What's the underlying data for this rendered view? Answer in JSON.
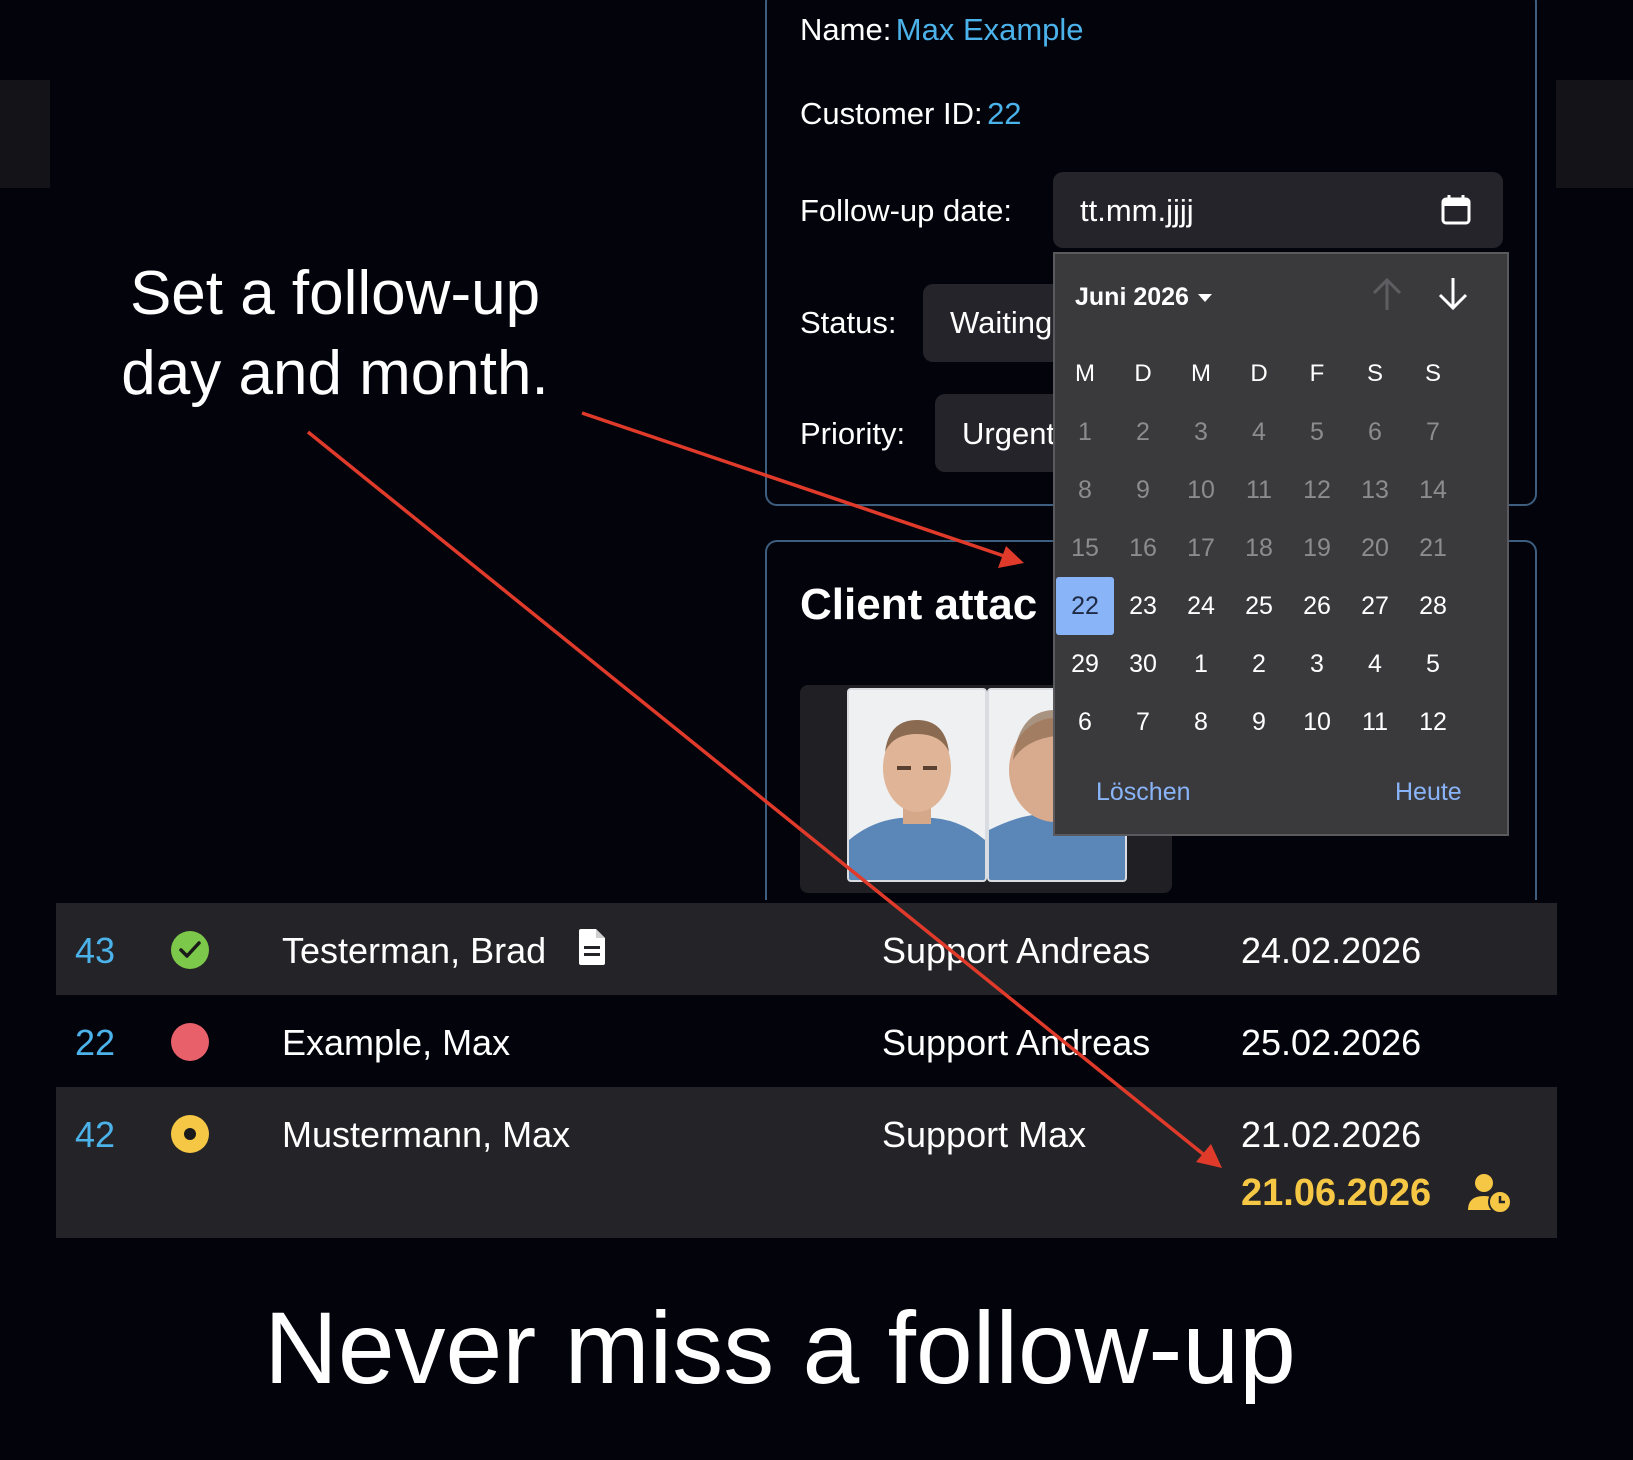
{
  "customer": {
    "name_label": "Name:",
    "name_value": "Max Example",
    "id_label": "Customer ID:",
    "id_value": "22",
    "followup_label": "Follow-up date:",
    "followup_placeholder": "tt.mm.jjjj",
    "status_label": "Status:",
    "status_value": "Waiting",
    "priority_label": "Priority:",
    "priority_value": "Urgent"
  },
  "attachments": {
    "title": "Client attac"
  },
  "calendar": {
    "month_label": "Juni 2026",
    "weekdays": [
      "M",
      "D",
      "M",
      "D",
      "F",
      "S",
      "S"
    ],
    "weeks": [
      [
        "1",
        "2",
        "3",
        "4",
        "5",
        "6",
        "7"
      ],
      [
        "8",
        "9",
        "10",
        "11",
        "12",
        "13",
        "14"
      ],
      [
        "15",
        "16",
        "17",
        "18",
        "19",
        "20",
        "21"
      ],
      [
        "22",
        "23",
        "24",
        "25",
        "26",
        "27",
        "28"
      ],
      [
        "29",
        "30",
        "1",
        "2",
        "3",
        "4",
        "5"
      ],
      [
        "6",
        "7",
        "8",
        "9",
        "10",
        "11",
        "12"
      ]
    ],
    "selected_day": "22",
    "clear_label": "Löschen",
    "today_label": "Heute",
    "icons": [
      "calendar-icon",
      "arrow-up-icon",
      "arrow-down-icon",
      "caret-down-icon"
    ]
  },
  "caption": {
    "line1": "Set a follow-up",
    "line2": "day and month."
  },
  "table": {
    "rows": [
      {
        "id": "43",
        "status_color": "#7cc84a",
        "status_icon": "check-circle-icon",
        "name": "Testerman, Brad",
        "has_document": true,
        "assignee": "Support Andreas",
        "date": "24.02.2026"
      },
      {
        "id": "22",
        "status_color": "#e8606a",
        "status_icon": "red-dot-icon",
        "name": "Example, Max",
        "assignee": "Support Andreas",
        "date": "25.02.2026"
      },
      {
        "id": "42",
        "status_color": "#f6c744",
        "status_icon": "yellow-ring-icon",
        "name": "Mustermann, Max",
        "assignee": "Support Max",
        "date": "21.02.2026",
        "followup": "21.06.2026",
        "followup_icon": "user-clock-icon"
      }
    ]
  },
  "tagline": "Never miss a follow-up",
  "colors": {
    "accent_blue": "#4cb2ea",
    "followup_yellow": "#f6c744",
    "arrow_red": "#e03a2a",
    "calendar_selected": "#8ab4f8"
  }
}
